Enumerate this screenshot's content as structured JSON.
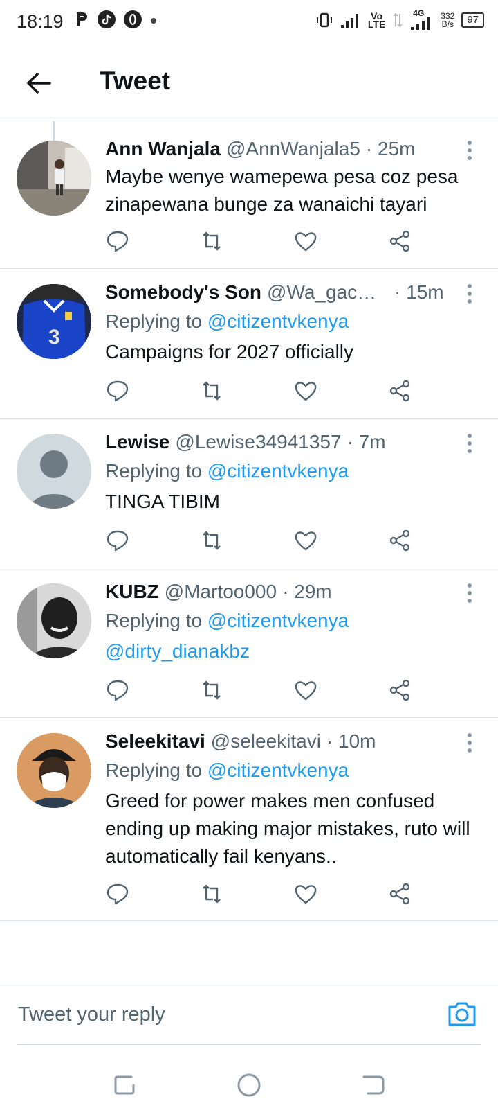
{
  "status_bar": {
    "time": "18:19",
    "volte": "Vo\nLTE",
    "network": "4G",
    "speed": "332\nB/s",
    "battery": "97"
  },
  "header": {
    "title": "Tweet"
  },
  "colors": {
    "link": "#1d9bf0",
    "secondary_text": "#536471",
    "divider": "#e1e6ea"
  },
  "tweets": [
    {
      "name": "Ann Wanjala",
      "handle": "@AnnWanjala5",
      "time": "· 25m",
      "replying_label": "",
      "replying_to": "",
      "text": "Maybe wenye wamepewa pesa coz pesa zinapewana bunge za wanaichi tayari"
    },
    {
      "name": "Somebody's Son",
      "handle": "@Wa_gaca...",
      "time": "· 15m",
      "replying_label": "Replying to ",
      "replying_to": "@citizentvkenya",
      "text": "Campaigns for 2027 officially"
    },
    {
      "name": "Lewise",
      "handle": "@Lewise34941357",
      "time": "· 7m",
      "replying_label": "Replying to ",
      "replying_to": "@citizentvkenya",
      "text": "TINGA TIBIM"
    },
    {
      "name": "KUBZ",
      "handle": "@Martoo000",
      "time": "· 29m",
      "replying_label": "Replying to ",
      "replying_to": "@citizentvkenya",
      "text": "@dirty_dianakbz"
    },
    {
      "name": "Seleekitavi",
      "handle": "@seleekitavi",
      "time": "· 10m",
      "replying_label": "Replying to ",
      "replying_to": "@citizentvkenya",
      "text": "Greed for power makes men confused ending up making major mistakes, ruto will automatically fail kenyans.."
    }
  ],
  "reply_box": {
    "placeholder": "Tweet your reply"
  },
  "icons": {
    "back": "arrow-left-icon",
    "reply": "speech-bubble-icon",
    "retweet": "retweet-icon",
    "like": "heart-icon",
    "share": "share-icon",
    "more": "more-vertical-icon",
    "camera": "camera-icon"
  }
}
